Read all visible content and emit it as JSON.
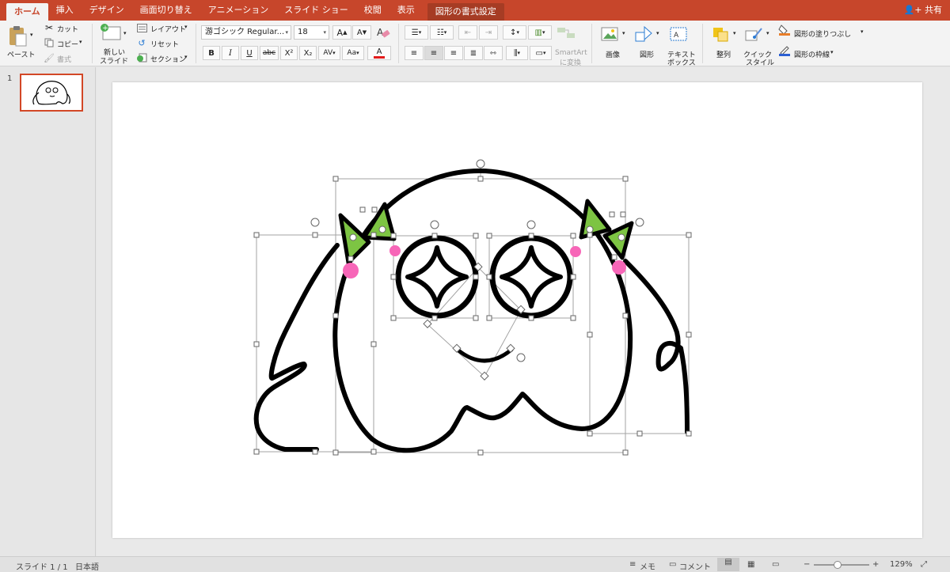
{
  "tabs": [
    "ホーム",
    "挿入",
    "デザイン",
    "画面切り替え",
    "アニメーション",
    "スライド ショー",
    "校閲",
    "表示"
  ],
  "context_tab": "図形の書式設定",
  "share_label": "共有",
  "clipboard": {
    "paste": "ペースト",
    "cut": "カット",
    "copy": "コピー",
    "format": "書式"
  },
  "slides_group": {
    "new_slide_line1": "新しい",
    "new_slide_line2": "スライド",
    "layout": "レイアウト",
    "reset": "リセット",
    "section": "セクション"
  },
  "font": {
    "name": "游ゴシック Regular...",
    "size": "18",
    "bold": "B",
    "italic": "I",
    "underline": "U",
    "strike": "abc",
    "superscript": "X²",
    "subscript": "X₂",
    "spacing": "AV",
    "case": "Aa",
    "color_label": "A"
  },
  "paragraph": {
    "smartart_line1": "SmartArt",
    "smartart_line2": "に変換"
  },
  "insert": {
    "picture": "画像",
    "shapes": "図形",
    "textbox_line1": "テキスト",
    "textbox_line2": "ボックス"
  },
  "arrange": {
    "arrange": "整列",
    "quick_line1": "クイック",
    "quick_line2": "スタイル",
    "fill": "図形の塗りつぶし",
    "outline": "図形の枠線"
  },
  "thumbnail": {
    "number": "1"
  },
  "status": {
    "slide_info": "スライド 1 / 1",
    "language": "日本語",
    "notes": "メモ",
    "comments": "コメント",
    "zoom": "129%"
  },
  "colors": {
    "accent": "#c7462b",
    "bow_green": "#7dc443",
    "bead_pink": "#f766b8"
  }
}
